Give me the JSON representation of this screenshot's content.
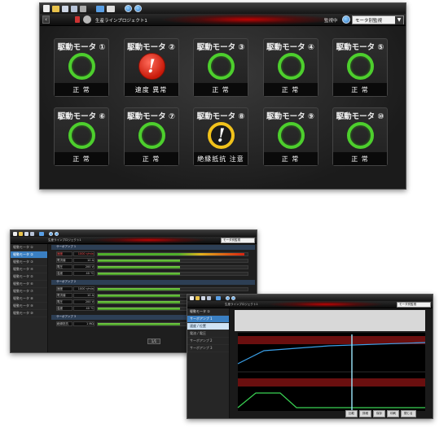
{
  "main": {
    "project_title": "生産ラインプロジェクト1",
    "monitoring_label": "監視中",
    "monitor_select": "モータ別監視",
    "tiles": [
      {
        "name": "駆動モータ ①",
        "status": "正 常",
        "state": "ok"
      },
      {
        "name": "駆動モータ ②",
        "status": "速度 異常",
        "state": "error"
      },
      {
        "name": "駆動モータ ③",
        "status": "正 常",
        "state": "ok"
      },
      {
        "name": "駆動モータ ④",
        "status": "正 常",
        "state": "ok"
      },
      {
        "name": "駆動モータ ⑤",
        "status": "正 常",
        "state": "ok"
      },
      {
        "name": "駆動モータ ⑥",
        "status": "正 常",
        "state": "ok"
      },
      {
        "name": "駆動モータ ⑦",
        "status": "正 常",
        "state": "ok"
      },
      {
        "name": "駆動モータ ⑧",
        "status": "絶縁抵抗 注意",
        "state": "warning"
      },
      {
        "name": "駆動モータ ⑨",
        "status": "正 常",
        "state": "ok"
      },
      {
        "name": "駆動モータ ⑩",
        "status": "正 常",
        "state": "ok"
      }
    ],
    "alert_mark": "!"
  },
  "detail": {
    "project_title": "生産ラインプロジェクト1",
    "monitor_select": "モータ別監視",
    "side_items": [
      "駆動モータ ①",
      "駆動モータ ②",
      "駆動モータ ③",
      "駆動モータ ④",
      "駆動モータ ⑤",
      "駆動モータ ⑥",
      "駆動モータ ⑦",
      "駆動モータ ⑧",
      "駆動モータ ⑨",
      "駆動モータ ⑩"
    ],
    "section1": "サーボアンプ 1",
    "section2": "サーボアンプ 2",
    "section3": "サーボアンプ 3",
    "rows1": [
      {
        "label": "速度",
        "value": "1000 r/min",
        "fill": 0.98,
        "alert": true
      },
      {
        "label": "電流値",
        "value": "10 A",
        "fill": 0.55,
        "alert": false
      },
      {
        "label": "電圧",
        "value": "200 V",
        "fill": 0.55,
        "alert": false
      },
      {
        "label": "温度",
        "value": "40 ℃",
        "fill": 0.55,
        "alert": false
      }
    ],
    "rows2": [
      {
        "label": "速度",
        "value": "1000 r/min",
        "fill": 0.55,
        "alert": false
      },
      {
        "label": "電流値",
        "value": "10 A",
        "fill": 0.55,
        "alert": false
      },
      {
        "label": "電圧",
        "value": "200 V",
        "fill": 0.55,
        "alert": false
      },
      {
        "label": "温度",
        "value": "40 ℃",
        "fill": 0.55,
        "alert": false
      }
    ],
    "rows3": [
      {
        "label": "絶縁抵抗",
        "value": "1 MΩ",
        "fill": 0.55,
        "alert": false
      }
    ],
    "pager": "1/1"
  },
  "graph": {
    "project_title": "生産ラインプロジェクト1",
    "monitor_select": "モータ別監視",
    "side_title": "駆動モータ ①",
    "side_items": [
      "サーボアンプ 1",
      "速度 / 位置",
      "電流 / 電圧",
      "サーボアンプ 2",
      "サーボアンプ 3"
    ],
    "tabs": [
      "比較",
      "詳細",
      "保存",
      "印刷",
      "閉じる"
    ]
  },
  "colors": {
    "ok": "#4dcf2d",
    "error": "#d8220f",
    "warning": "#f1c21b",
    "accent": "#3aa0e8"
  }
}
